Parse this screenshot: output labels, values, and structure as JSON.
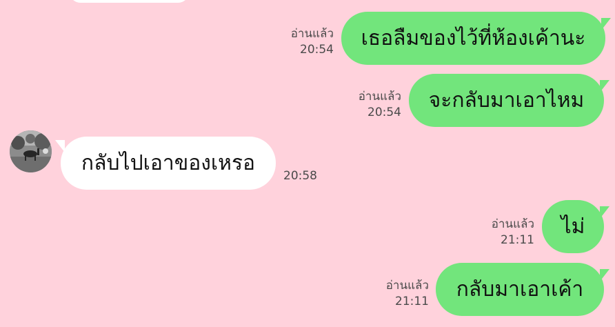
{
  "chat": {
    "read_label": "อ่านแล้ว",
    "messages": [
      {
        "text": "เธอลืมของไว้ที่ห้องเค้านะ",
        "time": "20:54"
      },
      {
        "text": "จะกลับมาเอาไหม",
        "time": "20:54"
      },
      {
        "text": "กลับไปเอาของเหรอ",
        "time": "20:58"
      },
      {
        "text": "ไม่",
        "time": "21:11"
      },
      {
        "text": "กลับมาเอาเค้า",
        "time": "21:11"
      }
    ]
  },
  "colors": {
    "background": "#ffd2dc",
    "outgoing_bubble": "#72e57c",
    "incoming_bubble": "#ffffff",
    "meta_text": "#4a4a4a"
  }
}
